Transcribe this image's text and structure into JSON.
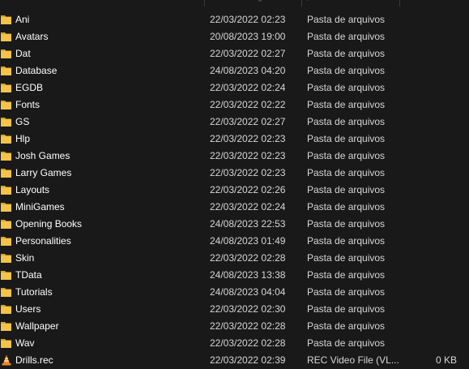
{
  "header": {
    "sort_glyph": "^",
    "type_glyph": "'"
  },
  "files": [
    {
      "name": "Ani",
      "modified": "22/03/2022 02:23",
      "type": "Pasta de arquivos",
      "size": "",
      "icon": "folder-icon"
    },
    {
      "name": "Avatars",
      "modified": "20/08/2023 19:00",
      "type": "Pasta de arquivos",
      "size": "",
      "icon": "folder-icon"
    },
    {
      "name": "Dat",
      "modified": "22/03/2022 02:27",
      "type": "Pasta de arquivos",
      "size": "",
      "icon": "folder-icon"
    },
    {
      "name": "Database",
      "modified": "24/08/2023 04:20",
      "type": "Pasta de arquivos",
      "size": "",
      "icon": "folder-icon"
    },
    {
      "name": "EGDB",
      "modified": "22/03/2022 02:24",
      "type": "Pasta de arquivos",
      "size": "",
      "icon": "folder-icon"
    },
    {
      "name": "Fonts",
      "modified": "22/03/2022 02:22",
      "type": "Pasta de arquivos",
      "size": "",
      "icon": "folder-icon"
    },
    {
      "name": "GS",
      "modified": "22/03/2022 02:27",
      "type": "Pasta de arquivos",
      "size": "",
      "icon": "folder-icon"
    },
    {
      "name": "Hlp",
      "modified": "22/03/2022 02:23",
      "type": "Pasta de arquivos",
      "size": "",
      "icon": "folder-icon"
    },
    {
      "name": "Josh Games",
      "modified": "22/03/2022 02:23",
      "type": "Pasta de arquivos",
      "size": "",
      "icon": "folder-icon"
    },
    {
      "name": "Larry Games",
      "modified": "22/03/2022 02:23",
      "type": "Pasta de arquivos",
      "size": "",
      "icon": "folder-icon"
    },
    {
      "name": "Layouts",
      "modified": "22/03/2022 02:26",
      "type": "Pasta de arquivos",
      "size": "",
      "icon": "folder-icon"
    },
    {
      "name": "MiniGames",
      "modified": "22/03/2022 02:24",
      "type": "Pasta de arquivos",
      "size": "",
      "icon": "folder-icon"
    },
    {
      "name": "Opening Books",
      "modified": "24/08/2023 22:53",
      "type": "Pasta de arquivos",
      "size": "",
      "icon": "folder-icon"
    },
    {
      "name": "Personalities",
      "modified": "24/08/2023 01:49",
      "type": "Pasta de arquivos",
      "size": "",
      "icon": "folder-icon"
    },
    {
      "name": "Skin",
      "modified": "22/03/2022 02:28",
      "type": "Pasta de arquivos",
      "size": "",
      "icon": "folder-icon"
    },
    {
      "name": "TData",
      "modified": "24/08/2023 13:38",
      "type": "Pasta de arquivos",
      "size": "",
      "icon": "folder-icon"
    },
    {
      "name": "Tutorials",
      "modified": "24/08/2023 04:04",
      "type": "Pasta de arquivos",
      "size": "",
      "icon": "folder-icon"
    },
    {
      "name": "Users",
      "modified": "22/03/2022 02:30",
      "type": "Pasta de arquivos",
      "size": "",
      "icon": "folder-icon"
    },
    {
      "name": "Wallpaper",
      "modified": "22/03/2022 02:28",
      "type": "Pasta de arquivos",
      "size": "",
      "icon": "folder-icon"
    },
    {
      "name": "Wav",
      "modified": "22/03/2022 02:28",
      "type": "Pasta de arquivos",
      "size": "",
      "icon": "folder-icon"
    },
    {
      "name": "Drills.rec",
      "modified": "22/03/2022 02:39",
      "type": "REC Video File (VL...",
      "size": "0 KB",
      "icon": "vlc-cone-icon"
    }
  ],
  "colors": {
    "background": "#191919",
    "folder_body": "#f3c34a",
    "folder_tab": "#d9a429",
    "vlc_orange": "#f08a1c"
  }
}
